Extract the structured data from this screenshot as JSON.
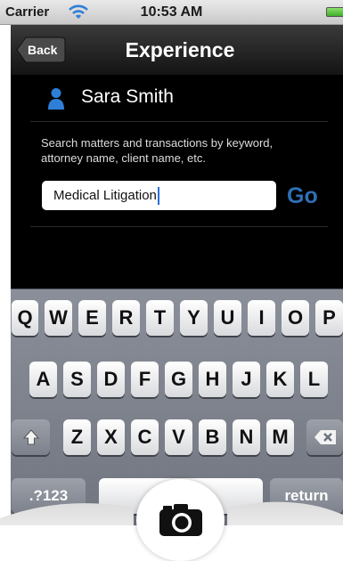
{
  "status_bar": {
    "carrier": "Carrier",
    "time": "10:53 AM"
  },
  "nav": {
    "back_label": "Back",
    "title": "Experience"
  },
  "user": {
    "name": "Sara Smith"
  },
  "search": {
    "hint": "Search matters and transactions by keyword, attorney name, client name, etc.",
    "value": "Medical Litigation",
    "go_label": "Go"
  },
  "keyboard": {
    "row1": [
      "Q",
      "W",
      "E",
      "R",
      "T",
      "Y",
      "U",
      "I",
      "O",
      "P"
    ],
    "row2": [
      "A",
      "S",
      "D",
      "F",
      "G",
      "H",
      "J",
      "K",
      "L"
    ],
    "row3": [
      "Z",
      "X",
      "C",
      "V",
      "B",
      "N",
      "M"
    ],
    "numbers_label": ".?123",
    "space_label": "space",
    "return_label": "return"
  },
  "icons": {
    "wifi": "wifi-icon",
    "battery": "battery-icon",
    "user": "person-icon",
    "shift": "shift-icon",
    "delete": "delete-icon",
    "camera": "camera-icon"
  },
  "colors": {
    "go": "#2f6fb7",
    "user_icon": "#2f7fd8",
    "caret": "#2b6ed8"
  }
}
